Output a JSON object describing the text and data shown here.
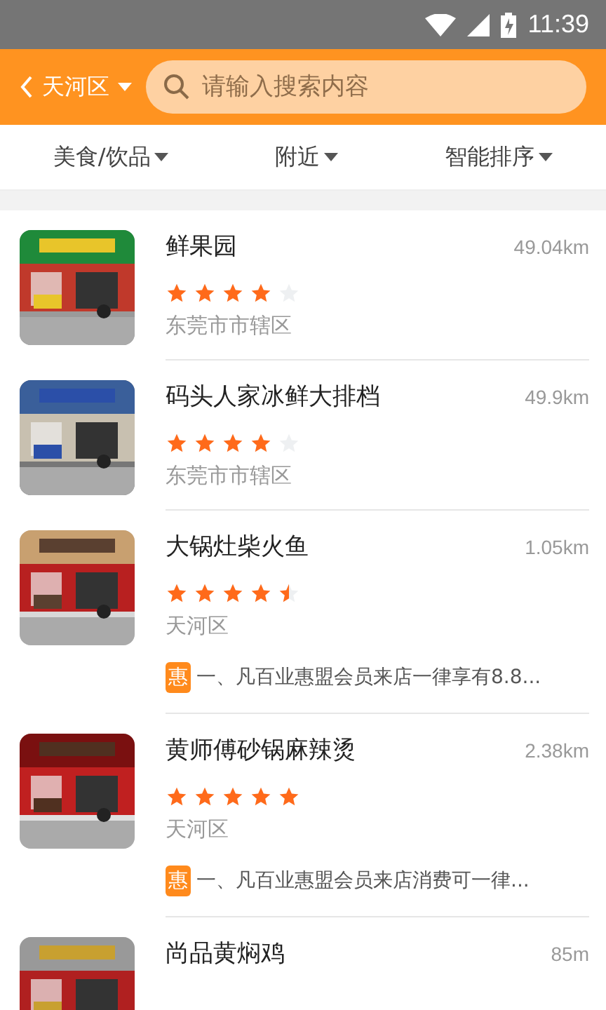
{
  "status_bar": {
    "time": "11:39"
  },
  "header": {
    "city": "天河区",
    "search": {
      "placeholder": "请输入搜索内容"
    }
  },
  "filters": [
    {
      "label": "美食/饮品"
    },
    {
      "label": "附近"
    },
    {
      "label": "智能排序"
    }
  ],
  "shops": [
    {
      "name": "鲜果园",
      "distance": "49.04km",
      "stars": 4,
      "area": "东莞市市辖区"
    },
    {
      "name": "码头人家冰鲜大排档",
      "distance": "49.9km",
      "stars": 4,
      "area": "东莞市市辖区"
    },
    {
      "name": "大锅灶柴火鱼",
      "distance": "1.05km",
      "stars": 4.5,
      "area": "天河区",
      "promo": {
        "badge": "惠",
        "text": "一、凡百业惠盟会员来店一律享有8.8..."
      }
    },
    {
      "name": "黄师傅砂锅麻辣烫",
      "distance": "2.38km",
      "stars": 5,
      "area": "天河区",
      "promo": {
        "badge": "惠",
        "text": "一、凡百业惠盟会员来店消费可一律..."
      }
    },
    {
      "name": "尚品黄焖鸡",
      "distance": "85m"
    }
  ]
}
